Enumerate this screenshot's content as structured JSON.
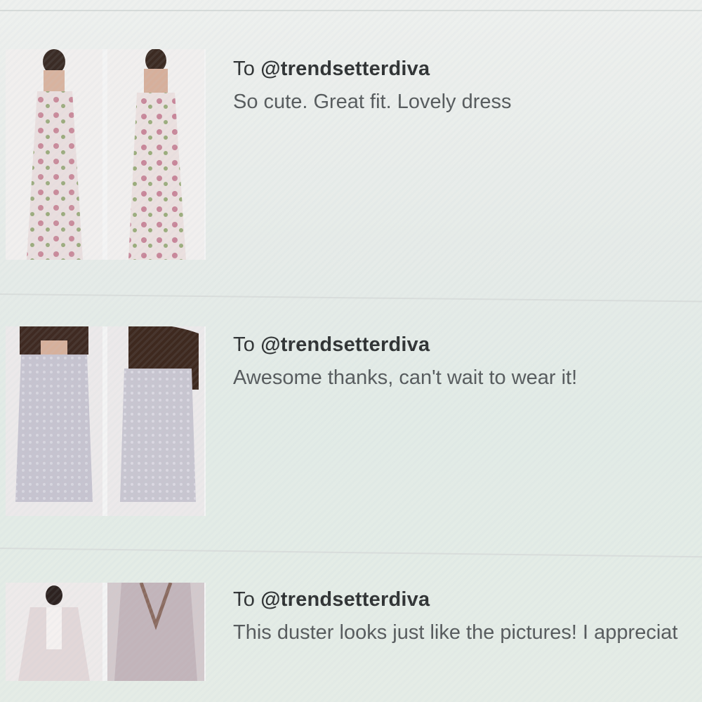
{
  "reviews": [
    {
      "to_prefix": "To ",
      "to_handle": "@trendsetterdiva",
      "message": "So cute. Great fit. Lovely dress"
    },
    {
      "to_prefix": "To ",
      "to_handle": "@trendsetterdiva",
      "message": "Awesome thanks, can't wait to wear it!"
    },
    {
      "to_prefix": "To ",
      "to_handle": "@trendsetterdiva",
      "message": "This duster looks just like the pictures! I appreciat"
    }
  ]
}
